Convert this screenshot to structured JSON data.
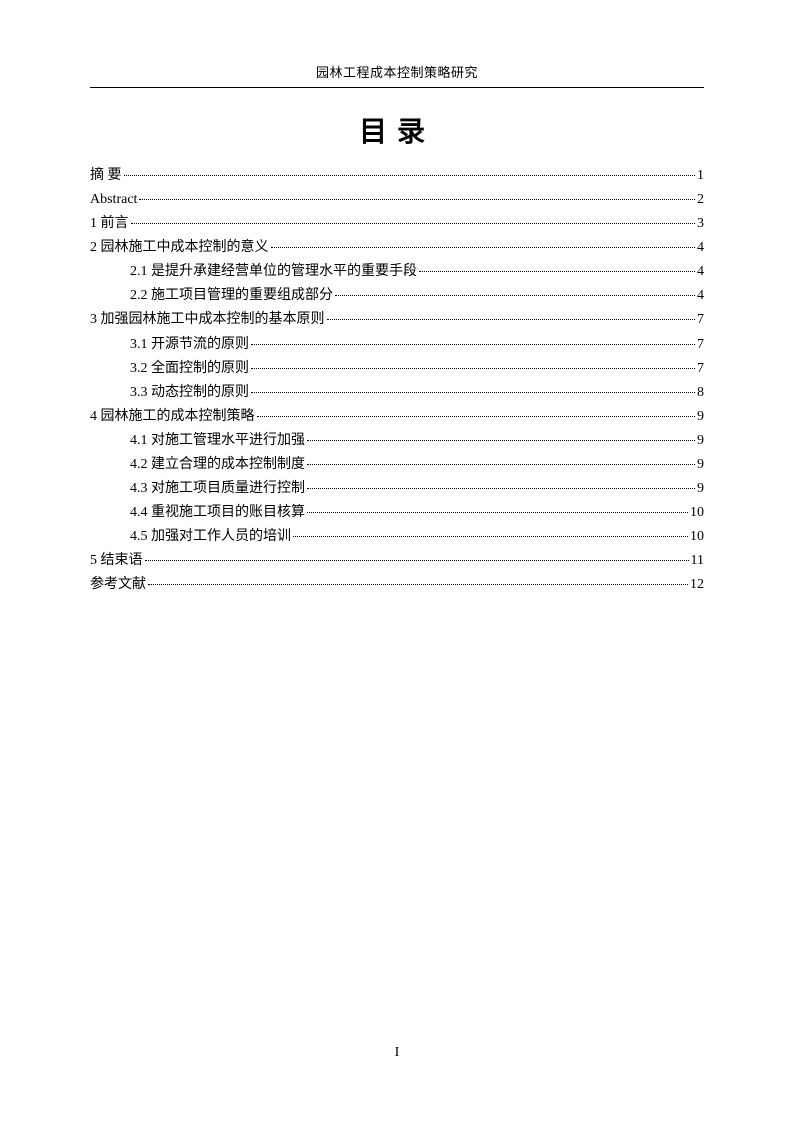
{
  "header": {
    "title": "园林工程成本控制策略研究"
  },
  "toc_title": "目录",
  "page_number": "I",
  "toc": [
    {
      "label": "摘 要",
      "page": "1",
      "indent": 0
    },
    {
      "label": "Abstract",
      "page": "2",
      "indent": 0,
      "cls": "abstract"
    },
    {
      "label": "1 前言",
      "page": "3",
      "indent": 0
    },
    {
      "label": "2 园林施工中成本控制的意义",
      "page": "4",
      "indent": 0
    },
    {
      "label": "2.1 是提升承建经营单位的管理水平的重要手段",
      "page": "4",
      "indent": 1
    },
    {
      "label": "2.2 施工项目管理的重要组成部分",
      "page": "4",
      "indent": 1
    },
    {
      "label": "3 加强园林施工中成本控制的基本原则",
      "page": "7",
      "indent": 0
    },
    {
      "label": "3.1 开源节流的原则",
      "page": "7",
      "indent": 1
    },
    {
      "label": "3.2 全面控制的原则",
      "page": "7",
      "indent": 1
    },
    {
      "label": "3.3 动态控制的原则",
      "page": "8",
      "indent": 1
    },
    {
      "label": "4 园林施工的成本控制策略",
      "page": "9",
      "indent": 0
    },
    {
      "label": "4.1 对施工管理水平进行加强",
      "page": "9",
      "indent": 1
    },
    {
      "label": "4.2 建立合理的成本控制制度",
      "page": "9",
      "indent": 1
    },
    {
      "label": "4.3 对施工项目质量进行控制",
      "page": "9",
      "indent": 1
    },
    {
      "label": "4.4 重视施工项目的账目核算",
      "page": "10",
      "indent": 1
    },
    {
      "label": "4.5 加强对工作人员的培训",
      "page": "10",
      "indent": 1
    },
    {
      "label": "5 结束语",
      "page": "11",
      "indent": 0
    },
    {
      "label": "参考文献",
      "page": "12",
      "indent": 0
    }
  ]
}
